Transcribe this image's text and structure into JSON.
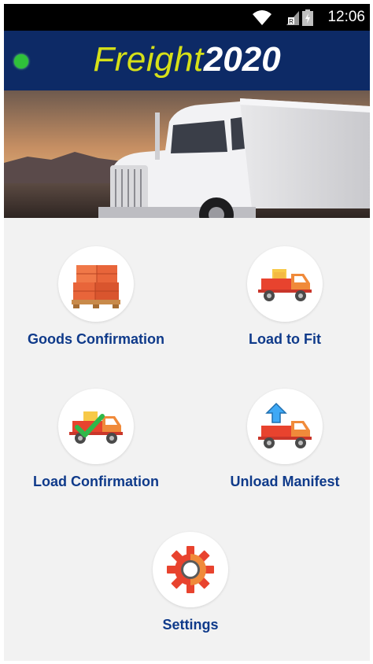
{
  "status_bar": {
    "time": "12:06"
  },
  "app": {
    "brand_part1": "Freight",
    "brand_part2": "2020"
  },
  "menu": {
    "goods_confirmation": "Goods Confirmation",
    "load_to_fit": "Load to Fit",
    "load_confirmation": "Load Confirmation",
    "unload_manifest": "Unload Manifest",
    "settings": "Settings"
  },
  "colors": {
    "header_bg": "#0d2a66",
    "brand_yellow": "#d6e018",
    "label_blue": "#0f3a8a",
    "status_green": "#2fc23a",
    "truck_red": "#e8432e",
    "truck_orange": "#f08a3a",
    "box_orange": "#e8653a"
  },
  "icons": {
    "goods_confirmation": "boxes-on-pallet-icon",
    "load_to_fit": "loaded-truck-icon",
    "load_confirmation": "truck-checkmark-icon",
    "unload_manifest": "truck-unload-arrow-icon",
    "settings": "gear-icon"
  }
}
